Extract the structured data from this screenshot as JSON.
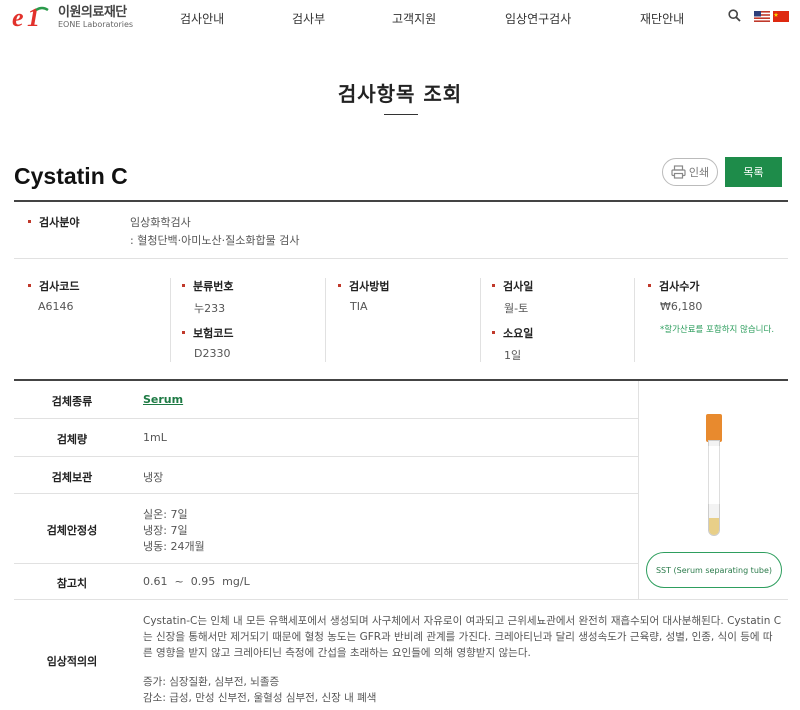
{
  "header": {
    "logo_ko": "이원의료재단",
    "logo_en": "EONE Laboratories",
    "nav": [
      "검사안내",
      "검사부",
      "고객지원",
      "임상연구검사",
      "재단안내"
    ],
    "icons": [
      "search-icon",
      "us-flag-icon",
      "china-flag-icon"
    ]
  },
  "page": {
    "title": "검사항목 조회",
    "test_name": "Cystatin C",
    "print_label": "인쇄",
    "list_label": "목록"
  },
  "category": {
    "label": "검사분야",
    "line1": "임상화학검사",
    "line2": ": 혈청단백·아미노산·질소화합물 검사"
  },
  "info": {
    "code_label": "검사코드",
    "code": "A6146",
    "class_label": "분류번호",
    "class": "누233",
    "insurance_label": "보험코드",
    "insurance": "D2330",
    "method_label": "검사방법",
    "method": "TIA",
    "day_label": "검사일",
    "day": "월-토",
    "duration_label": "소요일",
    "duration": "1일",
    "fee_label": "검사수가",
    "fee": "₩6,180",
    "fee_note": "*할가산료를 포함하지 않습니다."
  },
  "specimen": {
    "type_label": "검체종류",
    "type": "Serum",
    "volume_label": "검체량",
    "volume": "1mL",
    "storage_label": "검체보관",
    "storage": "냉장",
    "stability_label": "검체안정성",
    "stability": [
      "실온: 7일",
      "냉장: 7일",
      "냉동: 24개월"
    ],
    "ref_label": "참고치",
    "ref": "0.61  ~  0.95  mg/L",
    "tube_name": "SST (Serum separating tube)",
    "colors": {
      "tube_cap": "#e88a2e",
      "accent": "#1e8c4a"
    }
  },
  "clinical": {
    "label": "임상적의의",
    "lines": [
      "Cystatin-C는 인체 내 모든 유핵세포에서 생성되며 사구체에서 자유로이 여과되고 근위세뇨관에서 완전히 재흡수되어 대사분해된다. Cystatin C",
      "는 신장을 통해서만 제거되기 때문에 혈청 농도는 GFR과 반비례 관계를 가진다. 크레아티닌과 달리 생성속도가 근육량, 성별, 인종, 식이 등에 따",
      "른 영향을 받지 않고 크레아티닌 측정에 간섭을 초래하는 요인들에 의해 영향받지 않는다."
    ],
    "increase": "증가: 심장질환, 심부전, 뇌졸증",
    "decrease": "감소: 급성, 만성 신부전, 울혈성 심부전, 신장 내 폐색"
  }
}
